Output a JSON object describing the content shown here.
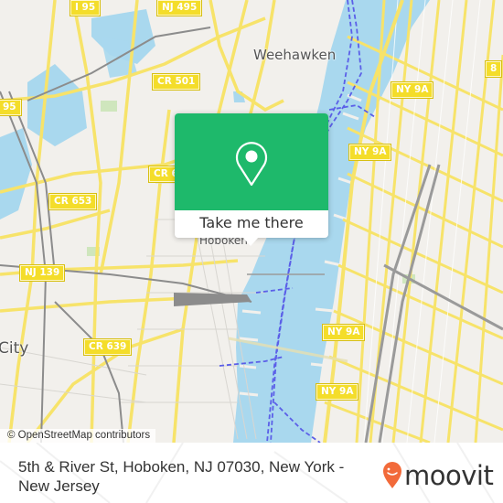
{
  "map": {
    "place_labels": [
      "Weehawken",
      "Hoboken",
      "City"
    ],
    "road_shields": [
      "I 95",
      "NJ 495",
      "CR 501",
      "95",
      "CR 653",
      "CR 6",
      "NJ 139",
      "CR 639",
      "NY 9A",
      "NY 9A",
      "NY 9A",
      "NY 9A",
      "8"
    ],
    "colors": {
      "land": "#f2f0ec",
      "water": "#a9d8ee",
      "road": "#f7e36a",
      "park": "#cfe6bd",
      "ferry": "#5b5fe8",
      "rail": "#8c8c8c"
    }
  },
  "popup": {
    "icon": "map-pin-icon",
    "button_label": "Take me there",
    "color": "#1eb96b"
  },
  "attribution": "© OpenStreetMap contributors",
  "footer": {
    "address": "5th & River St, Hoboken, NJ 07030, New York - New Jersey",
    "logo_text": "moovit",
    "logo_color": "#f26a3a"
  }
}
